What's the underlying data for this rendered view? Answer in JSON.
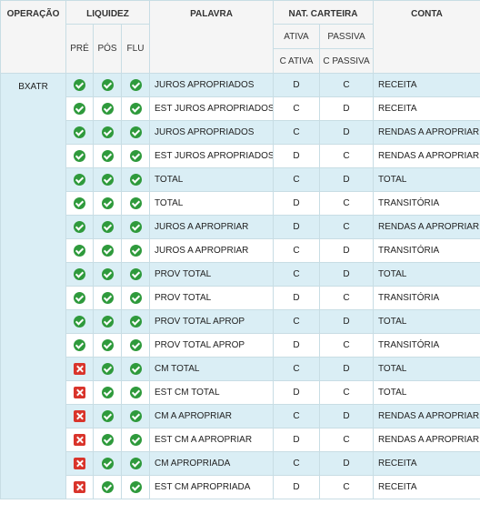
{
  "headers": {
    "operacao": "OPERAÇÃO",
    "liquidez": "LIQUIDEZ",
    "palavra": "PALAVRA",
    "nat_carteira": "NAT. CARTEIRA",
    "conta": "CONTA",
    "pre": "PRÉ",
    "pos": "PÓS",
    "flu": "FLU",
    "ativa": "ATIVA",
    "c_ativa": "C ATIVA",
    "passiva": "PASSIVA",
    "c_passiva": "C PASSIVA"
  },
  "operacao": "BXATR",
  "colors": {
    "ok": "#2f9a3c",
    "no": "#d9342b",
    "row_alt": "#daeef5",
    "border": "#c8dde4"
  },
  "icons": {
    "ok": "check-circle-icon",
    "no": "x-square-icon"
  },
  "rows": [
    {
      "pre": "ok",
      "pos": "ok",
      "flu": "ok",
      "palavra": "JUROS APROPRIADOS",
      "ativa": "D",
      "passiva": "C",
      "conta": "RECEITA"
    },
    {
      "pre": "ok",
      "pos": "ok",
      "flu": "ok",
      "palavra": "EST JUROS APROPRIADOS",
      "ativa": "C",
      "passiva": "D",
      "conta": "RECEITA"
    },
    {
      "pre": "ok",
      "pos": "ok",
      "flu": "ok",
      "palavra": "JUROS APROPRIADOS",
      "ativa": "C",
      "passiva": "D",
      "conta": "RENDAS A APROPRIAR"
    },
    {
      "pre": "ok",
      "pos": "ok",
      "flu": "ok",
      "palavra": "EST JUROS APROPRIADOS",
      "ativa": "D",
      "passiva": "C",
      "conta": "RENDAS A APROPRIAR"
    },
    {
      "pre": "ok",
      "pos": "ok",
      "flu": "ok",
      "palavra": "TOTAL",
      "ativa": "C",
      "passiva": "D",
      "conta": "TOTAL"
    },
    {
      "pre": "ok",
      "pos": "ok",
      "flu": "ok",
      "palavra": "TOTAL",
      "ativa": "D",
      "passiva": "C",
      "conta": "TRANSITÓRIA"
    },
    {
      "pre": "ok",
      "pos": "ok",
      "flu": "ok",
      "palavra": "JUROS A APROPRIAR",
      "ativa": "D",
      "passiva": "C",
      "conta": "RENDAS A APROPRIAR"
    },
    {
      "pre": "ok",
      "pos": "ok",
      "flu": "ok",
      "palavra": "JUROS A APROPRIAR",
      "ativa": "C",
      "passiva": "D",
      "conta": "TRANSITÓRIA"
    },
    {
      "pre": "ok",
      "pos": "ok",
      "flu": "ok",
      "palavra": "PROV TOTAL",
      "ativa": "C",
      "passiva": "D",
      "conta": "TOTAL"
    },
    {
      "pre": "ok",
      "pos": "ok",
      "flu": "ok",
      "palavra": "PROV TOTAL",
      "ativa": "D",
      "passiva": "C",
      "conta": "TRANSITÓRIA"
    },
    {
      "pre": "ok",
      "pos": "ok",
      "flu": "ok",
      "palavra": "PROV TOTAL APROP",
      "ativa": "C",
      "passiva": "D",
      "conta": "TOTAL"
    },
    {
      "pre": "ok",
      "pos": "ok",
      "flu": "ok",
      "palavra": "PROV TOTAL APROP",
      "ativa": "D",
      "passiva": "C",
      "conta": "TRANSITÓRIA"
    },
    {
      "pre": "no",
      "pos": "ok",
      "flu": "ok",
      "palavra": "CM TOTAL",
      "ativa": "C",
      "passiva": "D",
      "conta": "TOTAL"
    },
    {
      "pre": "no",
      "pos": "ok",
      "flu": "ok",
      "palavra": "EST CM TOTAL",
      "ativa": "D",
      "passiva": "C",
      "conta": "TOTAL"
    },
    {
      "pre": "no",
      "pos": "ok",
      "flu": "ok",
      "palavra": "CM A APROPRIAR",
      "ativa": "C",
      "passiva": "D",
      "conta": "RENDAS A APROPRIAR"
    },
    {
      "pre": "no",
      "pos": "ok",
      "flu": "ok",
      "palavra": "EST CM A APROPRIAR",
      "ativa": "D",
      "passiva": "C",
      "conta": "RENDAS A APROPRIAR"
    },
    {
      "pre": "no",
      "pos": "ok",
      "flu": "ok",
      "palavra": "CM APROPRIADA",
      "ativa": "C",
      "passiva": "D",
      "conta": "RECEITA"
    },
    {
      "pre": "no",
      "pos": "ok",
      "flu": "ok",
      "palavra": "EST CM APROPRIADA",
      "ativa": "D",
      "passiva": "C",
      "conta": "RECEITA"
    }
  ]
}
